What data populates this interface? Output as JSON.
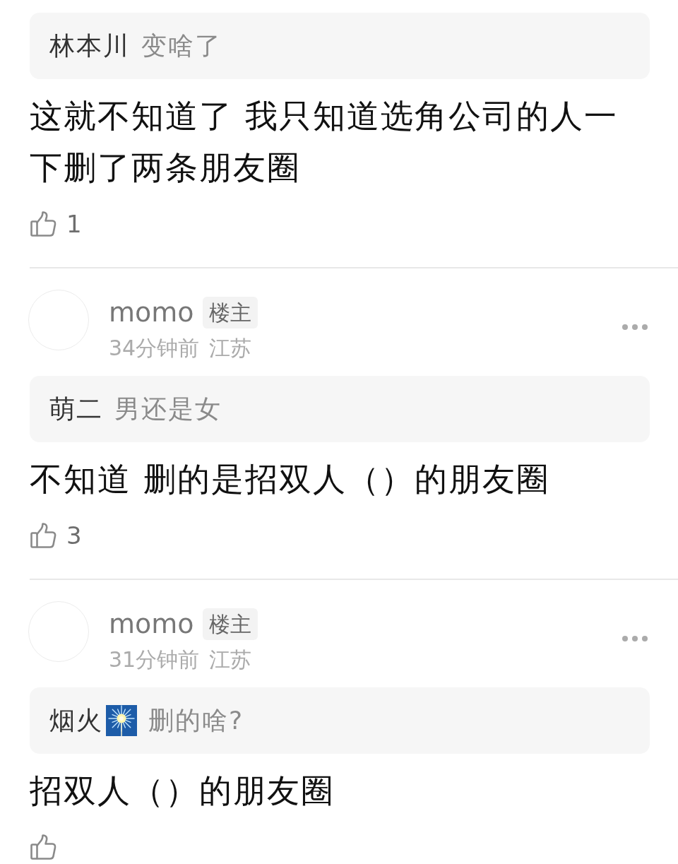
{
  "comments": [
    {
      "quote": {
        "author": "林本川",
        "text": "变啥了"
      },
      "body": "这就不知道了 我只知道选角公司的人一下删了两条朋友圈",
      "likes": "1"
    },
    {
      "user": {
        "name": "momo",
        "tag": "楼主",
        "time": "34分钟前",
        "location": "江苏"
      },
      "quote": {
        "author": "萌二",
        "text": "男还是女"
      },
      "body": "不知道 删的是招双人（）的朋友圈",
      "likes": "3"
    },
    {
      "user": {
        "name": "momo",
        "tag": "楼主",
        "time": "31分钟前",
        "location": "江苏"
      },
      "quote": {
        "author": "烟火",
        "author_emoji": true,
        "text": "删的啥?"
      },
      "body": "招双人（）的朋友圈"
    }
  ]
}
